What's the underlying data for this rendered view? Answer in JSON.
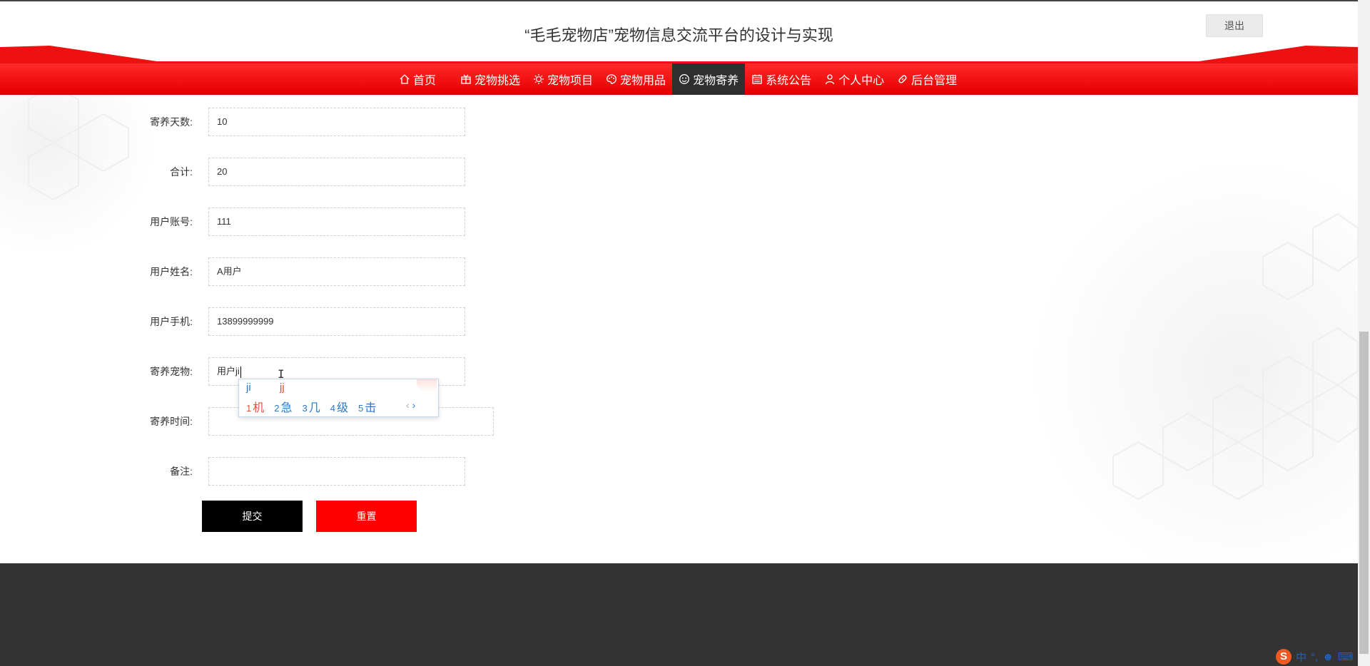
{
  "header": {
    "title": "“毛毛宠物店”宠物信息交流平台的设计与实现",
    "logout_label": "退出"
  },
  "nav": {
    "items": [
      {
        "label": "首页",
        "icon": "home-icon"
      },
      {
        "label": "宠物挑选",
        "icon": "gift-icon"
      },
      {
        "label": "宠物项目",
        "icon": "sun-icon"
      },
      {
        "label": "宠物用品",
        "icon": "palette-icon"
      },
      {
        "label": "宠物寄养",
        "icon": "smile-icon",
        "active": true
      },
      {
        "label": "系统公告",
        "icon": "calendar-icon"
      },
      {
        "label": "个人中心",
        "icon": "user-icon"
      },
      {
        "label": "后台管理",
        "icon": "link-icon"
      }
    ]
  },
  "form": {
    "fields": [
      {
        "label": "寄养天数:",
        "value": "10"
      },
      {
        "label": "合计:",
        "value": "20"
      },
      {
        "label": "用户账号:",
        "value": "111"
      },
      {
        "label": "用户姓名:",
        "value": "A用户"
      },
      {
        "label": "用户手机:",
        "value": "13899999999"
      },
      {
        "label": "寄养宠物:",
        "value": "用户ji"
      },
      {
        "label": "寄养时间:",
        "value": ""
      },
      {
        "label": "备注:",
        "value": ""
      }
    ],
    "submit_label": "提交",
    "reset_label": "重置"
  },
  "ime": {
    "composition": "ji",
    "hint": "jj",
    "candidates": [
      {
        "num": "1",
        "text": "机"
      },
      {
        "num": "2",
        "text": "急"
      },
      {
        "num": "3",
        "text": "几"
      },
      {
        "num": "4",
        "text": "级"
      },
      {
        "num": "5",
        "text": "击"
      }
    ],
    "prev_arrow": "‹",
    "next_arrow": "›"
  },
  "tray": {
    "ime_logo": "S",
    "lang": "中",
    "punct": "°,",
    "emoji": "☻",
    "keyboard": "⌨"
  },
  "colors": {
    "nav_red": "#ff1a1a",
    "nav_active": "#2f2f2f",
    "submit": "#000000",
    "reset": "#ff0000",
    "footer": "#333333"
  }
}
